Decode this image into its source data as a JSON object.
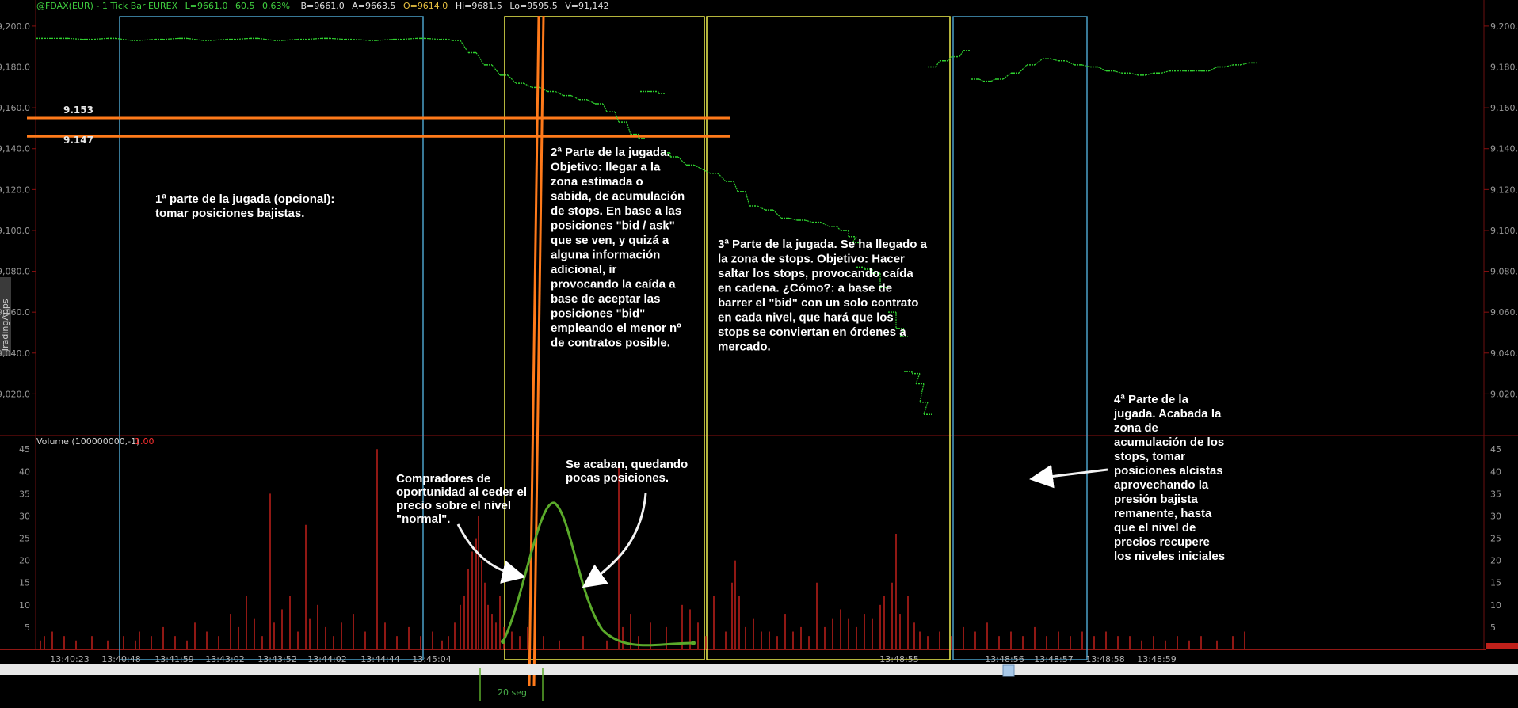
{
  "header": {
    "symbol": "@FDAX(EUR) - 1 Tick Bar  EUREX",
    "last": "L=9661.0",
    "change": "60.5",
    "pct": "0.63%",
    "bid": "B=9661.0",
    "ask": "A=9663.5",
    "open": "O=9614.0",
    "hi": "Hi=9681.5",
    "lo": "Lo=9595.5",
    "vol": "V=91,142"
  },
  "side_tab": "TradingApps",
  "colors": {
    "price": "#2fd22f",
    "volume": "#c0201a",
    "box_blue": "#4aa0c8",
    "box_yellow": "#f0f050",
    "level": "#ff7a1a",
    "divider": "#8a1010",
    "curve": "#5aaa2a"
  },
  "chart_data": [
    {
      "type": "line",
      "title": "",
      "ylim": [
        9000,
        9205
      ],
      "yticks": [
        "9,200.0",
        "9,180.0",
        "9,160.0",
        "9,140.0",
        "9,120.0",
        "9,100.0",
        "9,080.0",
        "9,060.0",
        "9,040.0",
        "9,020.0"
      ],
      "ytick_values": [
        9200,
        9180,
        9160,
        9140,
        9120,
        9100,
        9080,
        9060,
        9040,
        9020
      ],
      "levels": [
        {
          "label": "9.153",
          "value": 9155
        },
        {
          "label": "9.147",
          "value": 9146
        }
      ],
      "series": [
        {
          "values": [
            [
              0,
              9194
            ],
            [
              30,
              9194
            ],
            [
              60,
              9193.5
            ],
            [
              90,
              9194
            ],
            [
              120,
              9193
            ],
            [
              150,
              9193.5
            ],
            [
              180,
              9194
            ],
            [
              210,
              9193
            ],
            [
              240,
              9193.5
            ],
            [
              270,
              9194
            ],
            [
              300,
              9193
            ],
            [
              330,
              9193.5
            ],
            [
              360,
              9194
            ],
            [
              390,
              9193.5
            ],
            [
              420,
              9193
            ],
            [
              450,
              9193.5
            ],
            [
              480,
              9194
            ],
            [
              510,
              9193.5
            ],
            [
              525,
              9193
            ],
            [
              545,
              9187
            ],
            [
              565,
              9181
            ],
            [
              585,
              9176
            ],
            [
              605,
              9172
            ],
            [
              625,
              9170
            ],
            [
              645,
              9168
            ],
            [
              665,
              9166
            ],
            [
              685,
              9164
            ],
            [
              705,
              9162
            ],
            [
              720,
              9158
            ],
            [
              735,
              9153
            ],
            [
              750,
              9147
            ],
            [
              760,
              9145
            ],
            [
              762,
              9168
            ],
            [
              775,
              9168
            ],
            [
              785,
              9167
            ],
            [
              790,
              9138
            ],
            [
              800,
              9136
            ],
            [
              820,
              9132
            ],
            [
              850,
              9128
            ],
            [
              870,
              9124
            ],
            [
              885,
              9119
            ],
            [
              900,
              9112
            ],
            [
              920,
              9110
            ],
            [
              940,
              9106
            ],
            [
              960,
              9105
            ],
            [
              980,
              9104
            ],
            [
              1000,
              9102
            ],
            [
              1015,
              9100
            ],
            [
              1025,
              9097
            ],
            [
              1030,
              9094
            ],
            [
              1035,
              9082
            ],
            [
              1045,
              9081
            ],
            [
              1055,
              9079
            ],
            [
              1065,
              9072
            ],
            [
              1075,
              9060
            ],
            [
              1085,
              9052
            ],
            [
              1090,
              9048
            ],
            [
              1095,
              9031
            ],
            [
              1105,
              9030
            ],
            [
              1110,
              9025
            ],
            [
              1115,
              9016
            ],
            [
              1120,
              9010
            ],
            [
              1125,
              9180
            ],
            [
              1140,
              9183
            ],
            [
              1155,
              9185
            ],
            [
              1170,
              9188
            ],
            [
              1180,
              9174
            ],
            [
              1195,
              9173
            ],
            [
              1210,
              9174
            ],
            [
              1230,
              9177
            ],
            [
              1250,
              9181
            ],
            [
              1270,
              9184
            ],
            [
              1290,
              9183
            ],
            [
              1310,
              9181
            ],
            [
              1330,
              9180
            ],
            [
              1350,
              9178
            ],
            [
              1370,
              9177
            ],
            [
              1390,
              9176
            ],
            [
              1410,
              9177
            ],
            [
              1430,
              9178
            ],
            [
              1450,
              9178
            ],
            [
              1470,
              9178
            ],
            [
              1490,
              9180
            ],
            [
              1510,
              9181
            ],
            [
              1530,
              9182
            ]
          ]
        }
      ]
    },
    {
      "type": "bar",
      "title": "",
      "series_label": "Volume (100000000,-1)",
      "series_value": "1.00",
      "ylim": [
        0,
        47
      ],
      "yticks": [
        "45",
        "40",
        "35",
        "30",
        "25",
        "20",
        "15",
        "10",
        "5"
      ],
      "ytick_values": [
        45,
        40,
        35,
        30,
        25,
        20,
        15,
        10,
        5
      ],
      "xticks": [
        "13:40:23",
        "13:40:48",
        "13:41:59",
        "13:43:02",
        "13:43:52",
        "13:44:02",
        "13:44:44",
        "13:45:04",
        "13:48:55",
        "13:48:56",
        "13:48:57",
        "13:48:58",
        "13:48:59"
      ],
      "xtick_positions": [
        88,
        153,
        220,
        284,
        350,
        413,
        480,
        545,
        1135,
        1268,
        1330,
        1395,
        1460
      ],
      "bars": [
        [
          5,
          2
        ],
        [
          10,
          3
        ],
        [
          20,
          4
        ],
        [
          35,
          3
        ],
        [
          50,
          2
        ],
        [
          70,
          3
        ],
        [
          90,
          2
        ],
        [
          110,
          3
        ],
        [
          125,
          2
        ],
        [
          130,
          4
        ],
        [
          145,
          3
        ],
        [
          160,
          5
        ],
        [
          175,
          3
        ],
        [
          190,
          2
        ],
        [
          200,
          6
        ],
        [
          215,
          4
        ],
        [
          230,
          3
        ],
        [
          245,
          8
        ],
        [
          255,
          5
        ],
        [
          265,
          12
        ],
        [
          275,
          7
        ],
        [
          285,
          3
        ],
        [
          295,
          35
        ],
        [
          300,
          6
        ],
        [
          310,
          9
        ],
        [
          320,
          12
        ],
        [
          330,
          4
        ],
        [
          340,
          28
        ],
        [
          345,
          7
        ],
        [
          355,
          10
        ],
        [
          365,
          5
        ],
        [
          375,
          3
        ],
        [
          385,
          6
        ],
        [
          400,
          8
        ],
        [
          415,
          4
        ],
        [
          430,
          45
        ],
        [
          440,
          6
        ],
        [
          455,
          3
        ],
        [
          470,
          5
        ],
        [
          485,
          3
        ],
        [
          500,
          4
        ],
        [
          512,
          2
        ],
        [
          520,
          3
        ],
        [
          528,
          6
        ],
        [
          535,
          10
        ],
        [
          540,
          12
        ],
        [
          545,
          18
        ],
        [
          550,
          22
        ],
        [
          555,
          25
        ],
        [
          558,
          30
        ],
        [
          562,
          20
        ],
        [
          566,
          15
        ],
        [
          570,
          10
        ],
        [
          575,
          8
        ],
        [
          580,
          6
        ],
        [
          585,
          12
        ],
        [
          590,
          5
        ],
        [
          600,
          4
        ],
        [
          610,
          3
        ],
        [
          620,
          5
        ],
        [
          640,
          3
        ],
        [
          660,
          2
        ],
        [
          690,
          3
        ],
        [
          720,
          2
        ],
        [
          735,
          41
        ],
        [
          740,
          5
        ],
        [
          750,
          8
        ],
        [
          760,
          3
        ],
        [
          775,
          6
        ],
        [
          795,
          5
        ],
        [
          815,
          10
        ],
        [
          825,
          9
        ],
        [
          835,
          6
        ],
        [
          845,
          3
        ],
        [
          855,
          12
        ],
        [
          870,
          4
        ],
        [
          878,
          15
        ],
        [
          882,
          20
        ],
        [
          887,
          12
        ],
        [
          895,
          5
        ],
        [
          905,
          7
        ],
        [
          915,
          4
        ],
        [
          925,
          4
        ],
        [
          935,
          3
        ],
        [
          945,
          8
        ],
        [
          955,
          4
        ],
        [
          965,
          5
        ],
        [
          975,
          3
        ],
        [
          985,
          15
        ],
        [
          995,
          5
        ],
        [
          1005,
          7
        ],
        [
          1015,
          9
        ],
        [
          1025,
          7
        ],
        [
          1035,
          5
        ],
        [
          1045,
          8
        ],
        [
          1055,
          7
        ],
        [
          1065,
          10
        ],
        [
          1070,
          12
        ],
        [
          1080,
          15
        ],
        [
          1085,
          26
        ],
        [
          1090,
          8
        ],
        [
          1100,
          12
        ],
        [
          1108,
          6
        ],
        [
          1115,
          4
        ],
        [
          1125,
          3
        ],
        [
          1140,
          4
        ],
        [
          1155,
          3
        ],
        [
          1170,
          5
        ],
        [
          1185,
          4
        ],
        [
          1200,
          6
        ],
        [
          1215,
          3
        ],
        [
          1230,
          4
        ],
        [
          1245,
          3
        ],
        [
          1260,
          5
        ],
        [
          1275,
          3
        ],
        [
          1290,
          4
        ],
        [
          1305,
          3
        ],
        [
          1320,
          4
        ],
        [
          1335,
          3
        ],
        [
          1350,
          4
        ],
        [
          1365,
          3
        ],
        [
          1380,
          3
        ],
        [
          1395,
          2
        ],
        [
          1410,
          3
        ],
        [
          1425,
          2
        ],
        [
          1440,
          3
        ],
        [
          1455,
          2
        ],
        [
          1470,
          3
        ],
        [
          1490,
          2
        ],
        [
          1510,
          3
        ],
        [
          1525,
          4
        ]
      ]
    }
  ],
  "annotations": {
    "part1": [
      "1ª parte de la jugada (opcional):",
      "tomar posiciones bajistas."
    ],
    "part2": [
      "2ª Parte de la jugada.",
      "Objetivo: llegar a la",
      "zona estimada o",
      "sabida, de acumulación",
      "de stops. En base a las",
      "posiciones \"bid / ask\"",
      "que se ven, y quizá a",
      "alguna información",
      "adicional, ir",
      "provocando la caída a",
      "base de aceptar las",
      "posiciones \"bid\"",
      "empleando el menor nº",
      "de contratos posible."
    ],
    "part3": [
      "3ª Parte de la jugada. Se ha llegado a",
      "la zona de stops. Objetivo: Hacer",
      "saltar los stops, provocando caída",
      "en cadena. ¿Cómo?: a base de",
      "barrer el \"bid\" con un solo contrato",
      "en cada nivel, que hará que los",
      "stops se conviertan en órdenes a",
      "mercado."
    ],
    "part4": [
      "4ª Parte de la",
      "jugada. Acabada la",
      "zona de",
      "acumulación de los",
      "stops, tomar",
      "posiciones alcistas",
      "aprovechando la",
      "presión bajista",
      "remanente, hasta",
      "que el nivel de",
      "precios recupere",
      "los niveles iniciales"
    ],
    "buyers": [
      "Compradores de",
      "oportunidad al ceder el",
      "precio sobre el nivel",
      "\"normal\"."
    ],
    "exhaust": [
      "Se acaban, quedando",
      "pocas posiciones."
    ],
    "duration": "20 seg"
  }
}
